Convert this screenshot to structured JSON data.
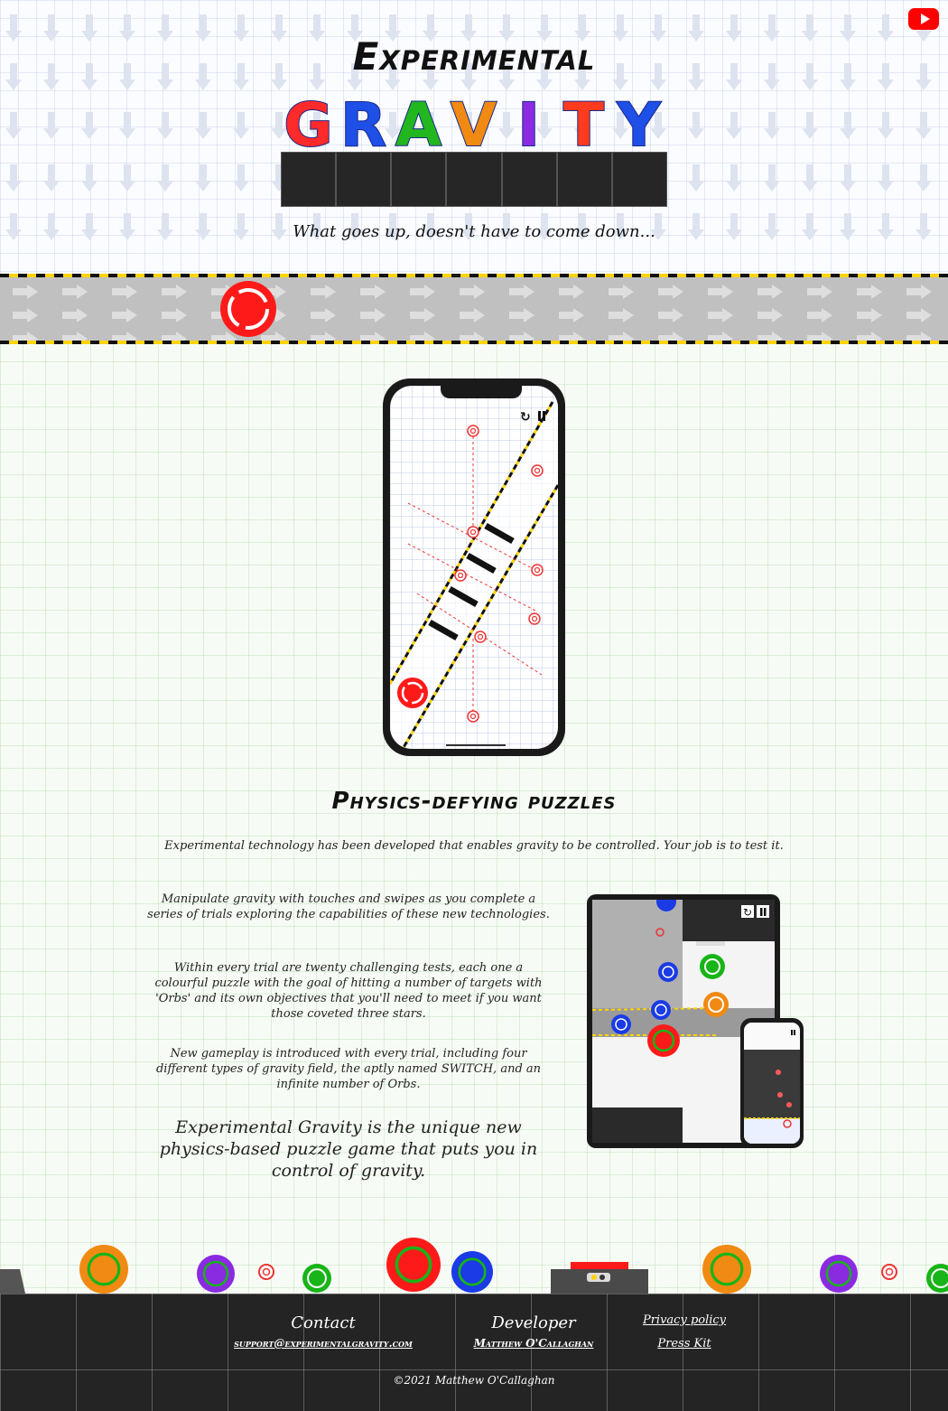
{
  "header": {
    "title_top": "Experimental",
    "title_letters": [
      {
        "char": "G",
        "color": "#ff2a2a"
      },
      {
        "char": "R",
        "color": "#1e4fe6"
      },
      {
        "char": "A",
        "color": "#22b61f"
      },
      {
        "char": "V",
        "color": "#f08a12"
      },
      {
        "char": "I",
        "color": "#8a2be2"
      },
      {
        "char": "T",
        "color": "#ff3b1f"
      },
      {
        "char": "Y",
        "color": "#1e4fe6"
      }
    ],
    "tagline": "What goes up, doesn't have to come down...",
    "youtube_icon": "youtube-icon"
  },
  "main": {
    "heading": "Physics-defying puzzles",
    "intro": "Experimental technology has been developed that enables gravity to be controlled. Your job is to test it.",
    "paragraphs": [
      "Manipulate gravity with touches and swipes as you complete a series of trials exploring the capabilities of these new technologies.",
      "Within every trial are twenty challenging tests, each one a colourful puzzle with the goal of hitting a number of targets with 'Orbs' and its own objectives that you'll need to meet if you want those coveted three stars.",
      "New gameplay is introduced with every trial, including four different types of gravity field, the aptly named SWITCH, and an infinite number of Orbs."
    ],
    "tagline_big": "Experimental Gravity is the unique new physics-based puzzle game that puts you in control of gravity."
  },
  "footer": {
    "contact_heading": "Contact",
    "contact_email": "support@experimentalgravity.com",
    "developer_heading": "Developer",
    "developer_name": "Matthew O'Callaghan",
    "privacy_link": "Privacy policy",
    "press_link": "Press Kit",
    "copyright": "©2021 Matthew O'Callaghan"
  },
  "colors": {
    "orb_red": "#ff1a1a",
    "orb_blue": "#1a3be6",
    "orb_green": "#18b418",
    "orb_orange": "#f08a12",
    "orb_purple": "#8a2be2",
    "hazard_yellow": "#ffd400",
    "footer_bg": "#242424"
  }
}
